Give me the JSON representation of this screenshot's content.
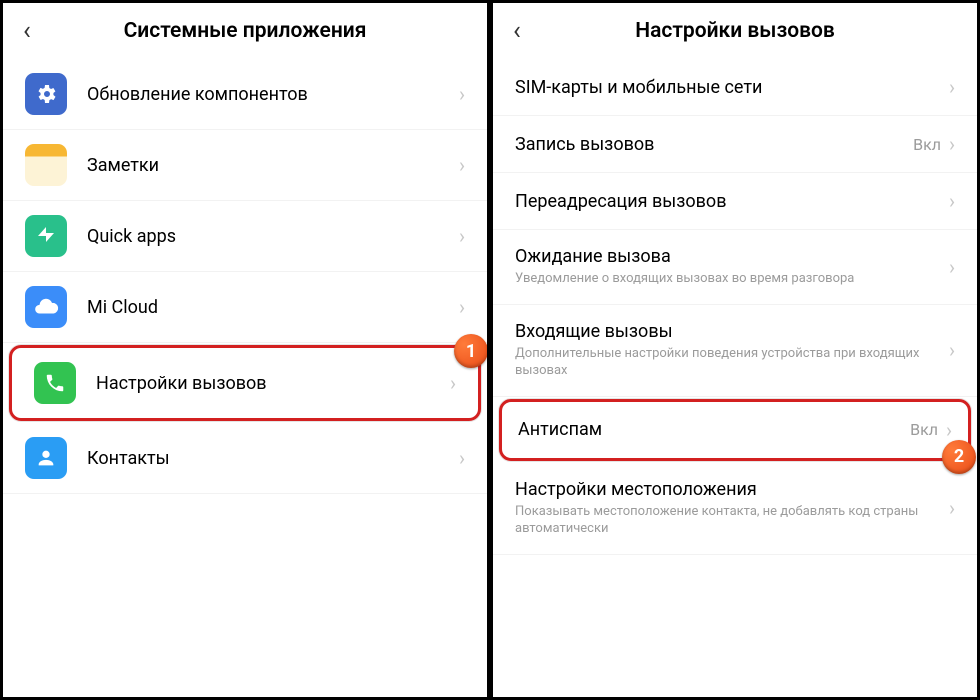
{
  "left": {
    "title": "Системные приложения",
    "items": [
      {
        "id": "updates",
        "label": "Обновление компонентов"
      },
      {
        "id": "notes",
        "label": "Заметки"
      },
      {
        "id": "quickapps",
        "label": "Quick apps"
      },
      {
        "id": "micloud",
        "label": "Mi Cloud"
      },
      {
        "id": "callsettings",
        "label": "Настройки вызовов"
      },
      {
        "id": "contacts",
        "label": "Контакты"
      }
    ],
    "badge": "1"
  },
  "right": {
    "title": "Настройки вызовов",
    "items": [
      {
        "id": "sim",
        "label": "SIM-карты и мобильные сети"
      },
      {
        "id": "record",
        "label": "Запись вызовов",
        "value": "Вкл"
      },
      {
        "id": "forward",
        "label": "Переадресация вызовов"
      },
      {
        "id": "waiting",
        "label": "Ожидание вызова",
        "sub": "Уведомление о входящих вызовах во время разговора"
      },
      {
        "id": "incoming",
        "label": "Входящие вызовы",
        "sub": "Дополнительные настройки поведения устройства при входящих вызовах"
      },
      {
        "id": "antispam",
        "label": "Антиспам",
        "value": "Вкл"
      },
      {
        "id": "location",
        "label": "Настройки местоположения",
        "sub": "Показывать местоположение контакта, не добавлять код страны автоматически"
      }
    ],
    "badge": "2"
  }
}
